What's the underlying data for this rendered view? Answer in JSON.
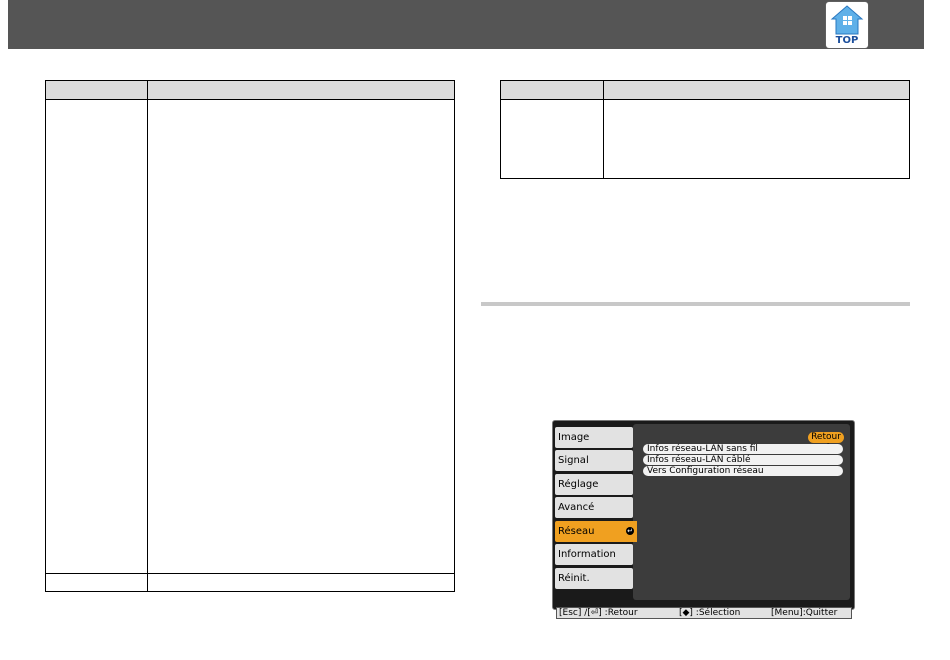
{
  "header": {
    "top_button": {
      "label": "TOP",
      "icon": "home-icon"
    }
  },
  "colors": {
    "header_bar": "#555555",
    "table_header": "#dcdcdc",
    "active_menu": "#f0a020",
    "top_icon_blue": "#1c4f9c"
  },
  "projector_menu": {
    "tabs": [
      {
        "label": "Image",
        "active": false
      },
      {
        "label": "Signal",
        "active": false
      },
      {
        "label": "Réglage",
        "active": false
      },
      {
        "label": "Avancé",
        "active": false
      },
      {
        "label": "Réseau",
        "active": true
      },
      {
        "label": "Information",
        "active": false
      },
      {
        "label": "Réinit.",
        "active": false
      }
    ],
    "return_button": "Retour",
    "submenu": [
      "Infos réseau-LAN sans fil",
      "Infos réseau-LAN câblé",
      "Vers Configuration réseau"
    ],
    "status_bar": {
      "back": "[Esc] /[⏎] :Retour",
      "select": "[◆] :Sélection",
      "quit": "[Menu]:Quitter"
    }
  }
}
